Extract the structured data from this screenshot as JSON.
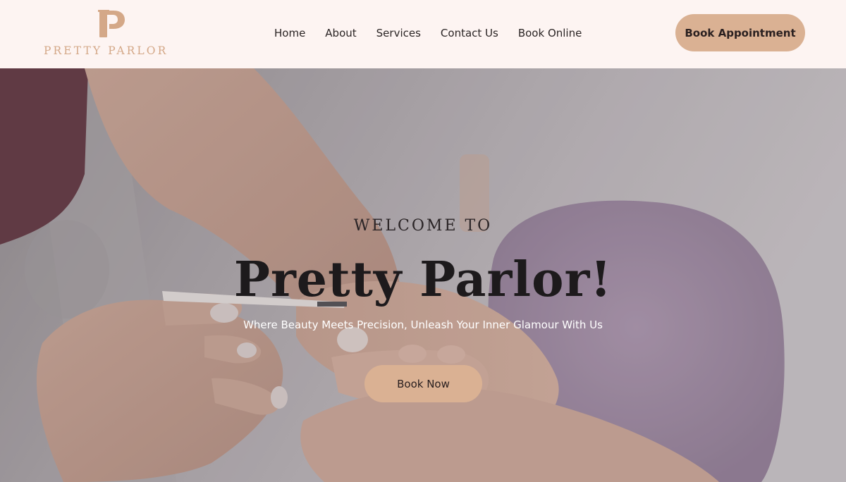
{
  "header": {
    "logo": {
      "letter": "P",
      "text": "PRETTY PARLOR",
      "color": "#d4a888"
    },
    "nav": [
      {
        "label": "Home"
      },
      {
        "label": "About"
      },
      {
        "label": "Services"
      },
      {
        "label": "Contact Us"
      },
      {
        "label": "Book Online"
      }
    ],
    "cta_label": "Book Appointment"
  },
  "hero": {
    "eyebrow": "WELCOME TO",
    "title": "Pretty Parlor!",
    "subtitle": "Where Beauty Meets Precision, Unleash Your Inner Glamour With Us",
    "cta_label": "Book Now",
    "image": "manicure-photo"
  },
  "colors": {
    "background": "#fdf4f2",
    "accent": "#dab193",
    "text": "#2a2424"
  }
}
